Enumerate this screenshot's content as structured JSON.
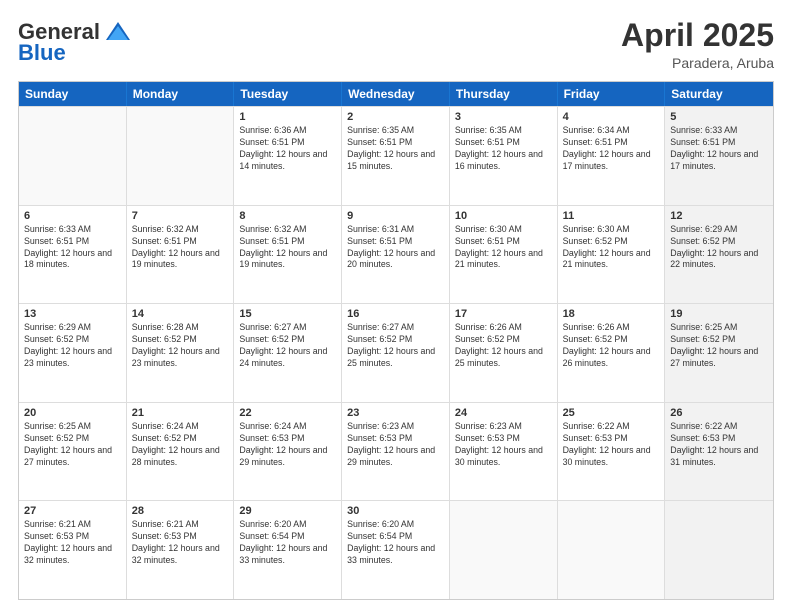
{
  "header": {
    "logo_general": "General",
    "logo_blue": "Blue",
    "month_title": "April 2025",
    "location": "Paradera, Aruba"
  },
  "days_of_week": [
    "Sunday",
    "Monday",
    "Tuesday",
    "Wednesday",
    "Thursday",
    "Friday",
    "Saturday"
  ],
  "rows": [
    [
      {
        "day": "",
        "info": "",
        "empty": true
      },
      {
        "day": "",
        "info": "",
        "empty": true
      },
      {
        "day": "1",
        "info": "Sunrise: 6:36 AM\nSunset: 6:51 PM\nDaylight: 12 hours and 14 minutes."
      },
      {
        "day": "2",
        "info": "Sunrise: 6:35 AM\nSunset: 6:51 PM\nDaylight: 12 hours and 15 minutes."
      },
      {
        "day": "3",
        "info": "Sunrise: 6:35 AM\nSunset: 6:51 PM\nDaylight: 12 hours and 16 minutes."
      },
      {
        "day": "4",
        "info": "Sunrise: 6:34 AM\nSunset: 6:51 PM\nDaylight: 12 hours and 17 minutes."
      },
      {
        "day": "5",
        "info": "Sunrise: 6:33 AM\nSunset: 6:51 PM\nDaylight: 12 hours and 17 minutes.",
        "shaded": true
      }
    ],
    [
      {
        "day": "6",
        "info": "Sunrise: 6:33 AM\nSunset: 6:51 PM\nDaylight: 12 hours and 18 minutes."
      },
      {
        "day": "7",
        "info": "Sunrise: 6:32 AM\nSunset: 6:51 PM\nDaylight: 12 hours and 19 minutes."
      },
      {
        "day": "8",
        "info": "Sunrise: 6:32 AM\nSunset: 6:51 PM\nDaylight: 12 hours and 19 minutes."
      },
      {
        "day": "9",
        "info": "Sunrise: 6:31 AM\nSunset: 6:51 PM\nDaylight: 12 hours and 20 minutes."
      },
      {
        "day": "10",
        "info": "Sunrise: 6:30 AM\nSunset: 6:51 PM\nDaylight: 12 hours and 21 minutes."
      },
      {
        "day": "11",
        "info": "Sunrise: 6:30 AM\nSunset: 6:52 PM\nDaylight: 12 hours and 21 minutes."
      },
      {
        "day": "12",
        "info": "Sunrise: 6:29 AM\nSunset: 6:52 PM\nDaylight: 12 hours and 22 minutes.",
        "shaded": true
      }
    ],
    [
      {
        "day": "13",
        "info": "Sunrise: 6:29 AM\nSunset: 6:52 PM\nDaylight: 12 hours and 23 minutes."
      },
      {
        "day": "14",
        "info": "Sunrise: 6:28 AM\nSunset: 6:52 PM\nDaylight: 12 hours and 23 minutes."
      },
      {
        "day": "15",
        "info": "Sunrise: 6:27 AM\nSunset: 6:52 PM\nDaylight: 12 hours and 24 minutes."
      },
      {
        "day": "16",
        "info": "Sunrise: 6:27 AM\nSunset: 6:52 PM\nDaylight: 12 hours and 25 minutes."
      },
      {
        "day": "17",
        "info": "Sunrise: 6:26 AM\nSunset: 6:52 PM\nDaylight: 12 hours and 25 minutes."
      },
      {
        "day": "18",
        "info": "Sunrise: 6:26 AM\nSunset: 6:52 PM\nDaylight: 12 hours and 26 minutes."
      },
      {
        "day": "19",
        "info": "Sunrise: 6:25 AM\nSunset: 6:52 PM\nDaylight: 12 hours and 27 minutes.",
        "shaded": true
      }
    ],
    [
      {
        "day": "20",
        "info": "Sunrise: 6:25 AM\nSunset: 6:52 PM\nDaylight: 12 hours and 27 minutes."
      },
      {
        "day": "21",
        "info": "Sunrise: 6:24 AM\nSunset: 6:52 PM\nDaylight: 12 hours and 28 minutes."
      },
      {
        "day": "22",
        "info": "Sunrise: 6:24 AM\nSunset: 6:53 PM\nDaylight: 12 hours and 29 minutes."
      },
      {
        "day": "23",
        "info": "Sunrise: 6:23 AM\nSunset: 6:53 PM\nDaylight: 12 hours and 29 minutes."
      },
      {
        "day": "24",
        "info": "Sunrise: 6:23 AM\nSunset: 6:53 PM\nDaylight: 12 hours and 30 minutes."
      },
      {
        "day": "25",
        "info": "Sunrise: 6:22 AM\nSunset: 6:53 PM\nDaylight: 12 hours and 30 minutes."
      },
      {
        "day": "26",
        "info": "Sunrise: 6:22 AM\nSunset: 6:53 PM\nDaylight: 12 hours and 31 minutes.",
        "shaded": true
      }
    ],
    [
      {
        "day": "27",
        "info": "Sunrise: 6:21 AM\nSunset: 6:53 PM\nDaylight: 12 hours and 32 minutes."
      },
      {
        "day": "28",
        "info": "Sunrise: 6:21 AM\nSunset: 6:53 PM\nDaylight: 12 hours and 32 minutes."
      },
      {
        "day": "29",
        "info": "Sunrise: 6:20 AM\nSunset: 6:54 PM\nDaylight: 12 hours and 33 minutes."
      },
      {
        "day": "30",
        "info": "Sunrise: 6:20 AM\nSunset: 6:54 PM\nDaylight: 12 hours and 33 minutes."
      },
      {
        "day": "",
        "info": "",
        "empty": true
      },
      {
        "day": "",
        "info": "",
        "empty": true
      },
      {
        "day": "",
        "info": "",
        "empty": true,
        "shaded": true
      }
    ]
  ]
}
